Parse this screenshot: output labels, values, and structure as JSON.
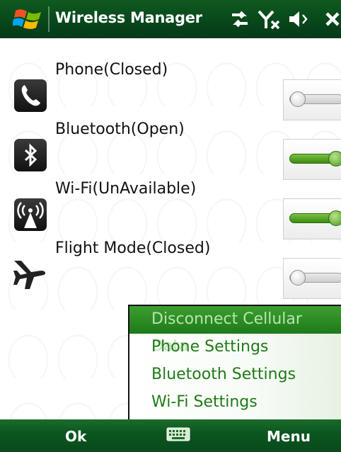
{
  "header": {
    "title": "Wireless Manager",
    "icons": [
      "windows-logo",
      "data-connection-icon",
      "no-signal-icon",
      "volume-icon",
      "close-icon"
    ]
  },
  "rows": [
    {
      "label": "Phone(Closed)",
      "icon": "phone-icon",
      "toggle_on": false
    },
    {
      "label": "Bluetooth(Open)",
      "icon": "bluetooth-icon",
      "toggle_on": true
    },
    {
      "label": "Wi-Fi(UnAvailable)",
      "icon": "wifi-icon",
      "toggle_on": true
    },
    {
      "label": "Flight Mode(Closed)",
      "icon": "airplane-icon",
      "toggle_on": false
    }
  ],
  "menu": {
    "items": [
      {
        "label": "Disconnect Cellular Data",
        "enabled": false
      },
      {
        "label": "Phone Settings",
        "enabled": true
      },
      {
        "label": "Bluetooth Settings",
        "enabled": true
      },
      {
        "label": "Wi-Fi Settings",
        "enabled": true
      }
    ]
  },
  "softkeys": {
    "left": "Ok",
    "right": "Menu",
    "center_icon": "keyboard-icon"
  },
  "colors": {
    "bar_green": "#0b5520",
    "menu_text": "#1f7a17",
    "toggle_on": "#3c8a12"
  }
}
